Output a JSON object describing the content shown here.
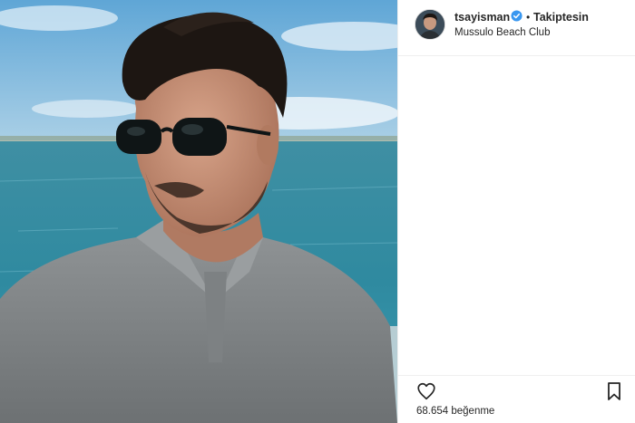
{
  "post": {
    "username": "tsayisman",
    "separator": "•",
    "follow_state": "Takiptesin",
    "location": "Mussulo Beach Club",
    "likes_text": "68.654 beğenme"
  },
  "icons": {
    "verified": "verified-badge-icon",
    "like": "heart-outline-icon",
    "save": "bookmark-outline-icon"
  },
  "colors": {
    "verified_blue": "#3897f0",
    "text": "#262626",
    "border": "#efefef"
  }
}
